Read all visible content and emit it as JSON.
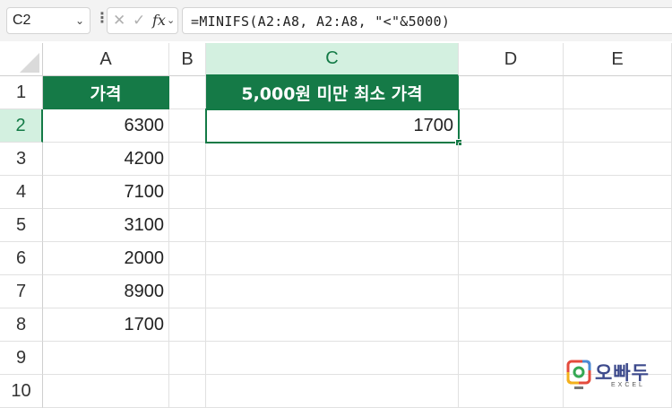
{
  "formula_bar": {
    "name_box": "C2",
    "cancel_icon": "✕",
    "enter_icon": "✓",
    "fx_label": "fx",
    "formula": "=MINIFS(A2:A8, A2:A8, \"<\"&5000)"
  },
  "columns": [
    "A",
    "B",
    "C",
    "D",
    "E"
  ],
  "rows": [
    "1",
    "2",
    "3",
    "4",
    "5",
    "6",
    "7",
    "8",
    "9",
    "10"
  ],
  "cells": {
    "A1": "가격",
    "A2": "6300",
    "A3": "4200",
    "A4": "7100",
    "A5": "3100",
    "A6": "2000",
    "A7": "8900",
    "A8": "1700",
    "C1": "5,000원 미만 최소 가격",
    "C2": "1700"
  },
  "selected_cell": "C2",
  "colors": {
    "header_fill": "#157a47",
    "selection": "#137a46",
    "selected_header_bg": "#d3f0e0"
  },
  "logo": {
    "brand": "오빠두",
    "sub": "EXCEL"
  }
}
